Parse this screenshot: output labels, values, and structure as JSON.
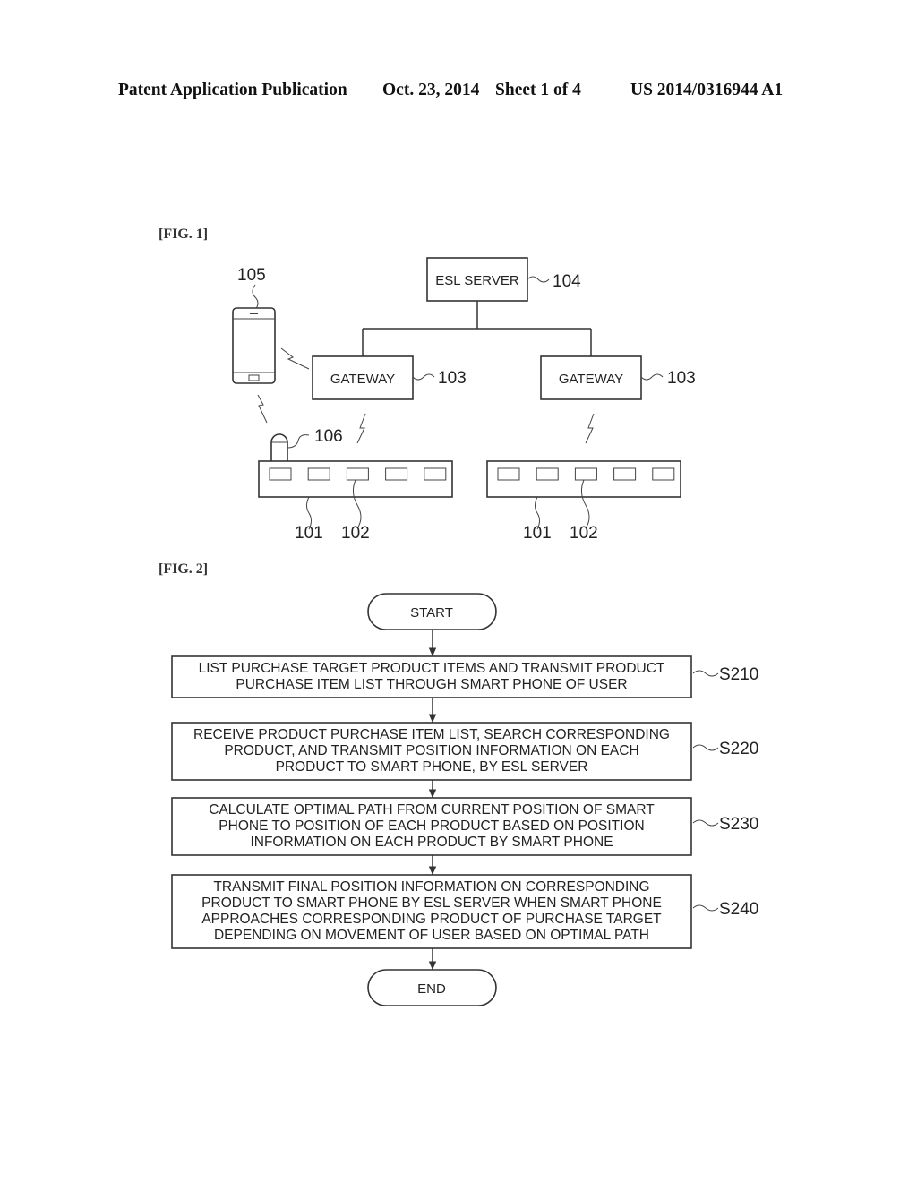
{
  "header": {
    "publication": "Patent Application Publication",
    "date": "Oct. 23, 2014",
    "sheet": "Sheet 1 of 4",
    "number": "US 2014/0316944 A1"
  },
  "fig1": {
    "label": "[FIG. 1]",
    "server": {
      "text": "ESL SERVER",
      "ref": "104"
    },
    "gateway_left": {
      "text": "GATEWAY",
      "ref": "103"
    },
    "gateway_right": {
      "text": "GATEWAY",
      "ref": "103"
    },
    "phone_ref": "105",
    "reader_ref": "106",
    "shelf_left": {
      "shelf_ref": "101",
      "tag_ref": "102",
      "tag_count": 5
    },
    "shelf_right": {
      "shelf_ref": "101",
      "tag_ref": "102",
      "tag_count": 5
    }
  },
  "fig2": {
    "label": "[FIG. 2]",
    "start": "START",
    "end": "END",
    "steps": [
      {
        "ref": "S210",
        "lines": [
          "LIST PURCHASE TARGET PRODUCT ITEMS AND TRANSMIT PRODUCT",
          "PURCHASE ITEM LIST THROUGH SMART PHONE OF USER"
        ]
      },
      {
        "ref": "S220",
        "lines": [
          "RECEIVE PRODUCT PURCHASE ITEM LIST, SEARCH CORRESPONDING",
          "PRODUCT, AND TRANSMIT POSITION INFORMATION ON EACH",
          "PRODUCT TO SMART PHONE, BY ESL SERVER"
        ]
      },
      {
        "ref": "S230",
        "lines": [
          "CALCULATE OPTIMAL PATH FROM CURRENT POSITION OF SMART",
          "PHONE TO POSITION OF EACH PRODUCT BASED ON POSITION",
          "INFORMATION ON EACH PRODUCT BY SMART PHONE"
        ]
      },
      {
        "ref": "S240",
        "lines": [
          "TRANSMIT FINAL POSITION INFORMATION ON CORRESPONDING",
          "PRODUCT TO SMART PHONE BY ESL SERVER WHEN SMART PHONE",
          "APPROACHES CORRESPONDING PRODUCT OF PURCHASE TARGET",
          "DEPENDING ON MOVEMENT OF USER BASED ON OPTIMAL PATH"
        ]
      }
    ]
  }
}
